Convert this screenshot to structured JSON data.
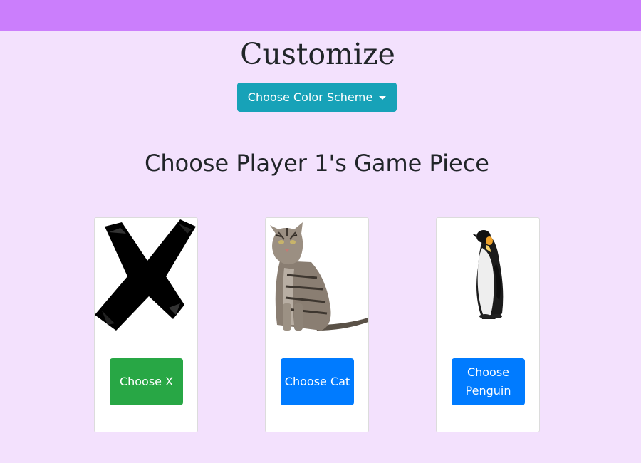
{
  "page": {
    "title": "Customize",
    "color_scheme_button": "Choose Color Scheme",
    "section_title": "Choose Player 1's Game Piece"
  },
  "colors": {
    "topbar": "#cb7efc",
    "background": "#f3e1fd",
    "scheme_button": "#17a2b8",
    "selected_button": "#28a745",
    "unselected_button": "#007bff"
  },
  "pieces": [
    {
      "image": "x-mark",
      "button_label": "Choose X",
      "selected": true
    },
    {
      "image": "cat",
      "button_label": "Choose Cat",
      "selected": false
    },
    {
      "image": "penguin",
      "button_label": "Choose Penguin",
      "selected": false
    }
  ]
}
